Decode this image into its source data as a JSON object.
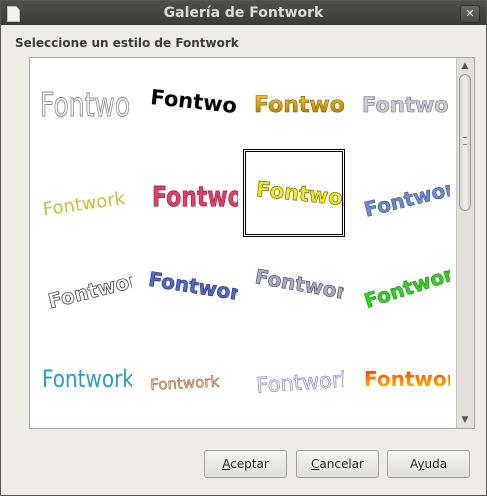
{
  "window": {
    "title": "Galería de Fontwork",
    "close_glyph": "✕"
  },
  "prompt": "Seleccione un estilo de Fontwork",
  "gallery": {
    "items": [
      {
        "text": "Fontwork"
      },
      {
        "text": "Fontwork"
      },
      {
        "text": "Fontwork"
      },
      {
        "text": "Fontwork"
      },
      {
        "text": "Fontwork"
      },
      {
        "text": "Fontwork"
      },
      {
        "text": "Fontwork"
      },
      {
        "text": "Fontwork"
      },
      {
        "text": "Fontwork"
      },
      {
        "text": "Fontwork"
      },
      {
        "text": "Fontwork"
      },
      {
        "text": "Fontwork"
      },
      {
        "text": "Fontwork"
      },
      {
        "text": "Fontwork"
      },
      {
        "text": "Fontwork"
      },
      {
        "text": "Fontwork"
      }
    ],
    "selected_index": 6
  },
  "scroll": {
    "up": "▲",
    "down": "▼"
  },
  "buttons": {
    "accept": {
      "label": "Aceptar",
      "mnemonic": "A",
      "rest": "ceptar"
    },
    "cancel": {
      "label": "Cancelar",
      "mnemonic": "C",
      "rest": "ancelar"
    },
    "help": {
      "label": "Ayuda",
      "mnemonic": "y",
      "pre": "A",
      "rest": "uda"
    }
  },
  "colors": {
    "titlebar": "#3c3b37",
    "window_bg": "#efebe7",
    "gallery_bg": "#ffffff"
  }
}
